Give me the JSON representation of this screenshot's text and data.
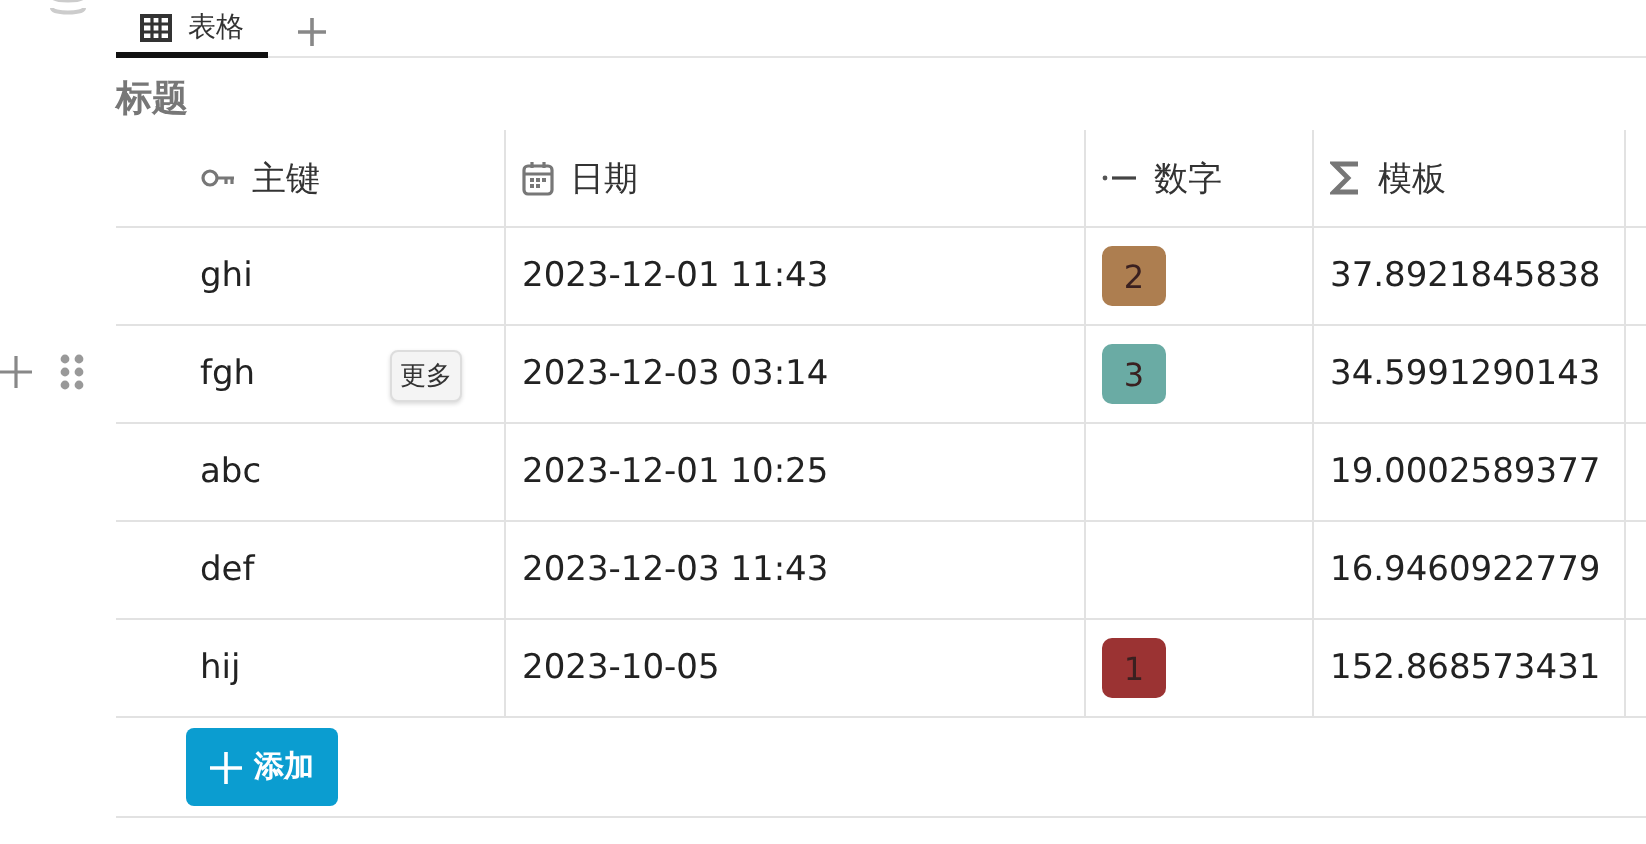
{
  "tabs": [
    {
      "label": "表格",
      "selected": true
    }
  ],
  "title": "标题",
  "columns": [
    {
      "kind": "key",
      "label": "主键"
    },
    {
      "kind": "date",
      "label": "日期"
    },
    {
      "kind": "number",
      "label": "数字"
    },
    {
      "kind": "formula",
      "label": "模板"
    }
  ],
  "row_action_label": "更多",
  "rows": [
    {
      "key": "ghi",
      "date": "2023-12-01 11:43",
      "number": {
        "text": "2",
        "color": "#ad7e50"
      },
      "template": "37.8921845838",
      "hovered": false
    },
    {
      "key": "fgh",
      "date": "2023-12-03 03:14",
      "number": {
        "text": "3",
        "color": "#6aaba4"
      },
      "template": "34.5991290143",
      "hovered": true
    },
    {
      "key": "abc",
      "date": "2023-12-01 10:25",
      "template": "19.0002589377",
      "hovered": false
    },
    {
      "key": "def",
      "date": "2023-12-03 11:43",
      "template": "16.9460922779",
      "hovered": false
    },
    {
      "key": "hij",
      "date": "2023-10-05",
      "number": {
        "text": "1",
        "color": "#9b3333"
      },
      "template": "152.868573431",
      "hovered": false
    }
  ],
  "add_button": "添加"
}
